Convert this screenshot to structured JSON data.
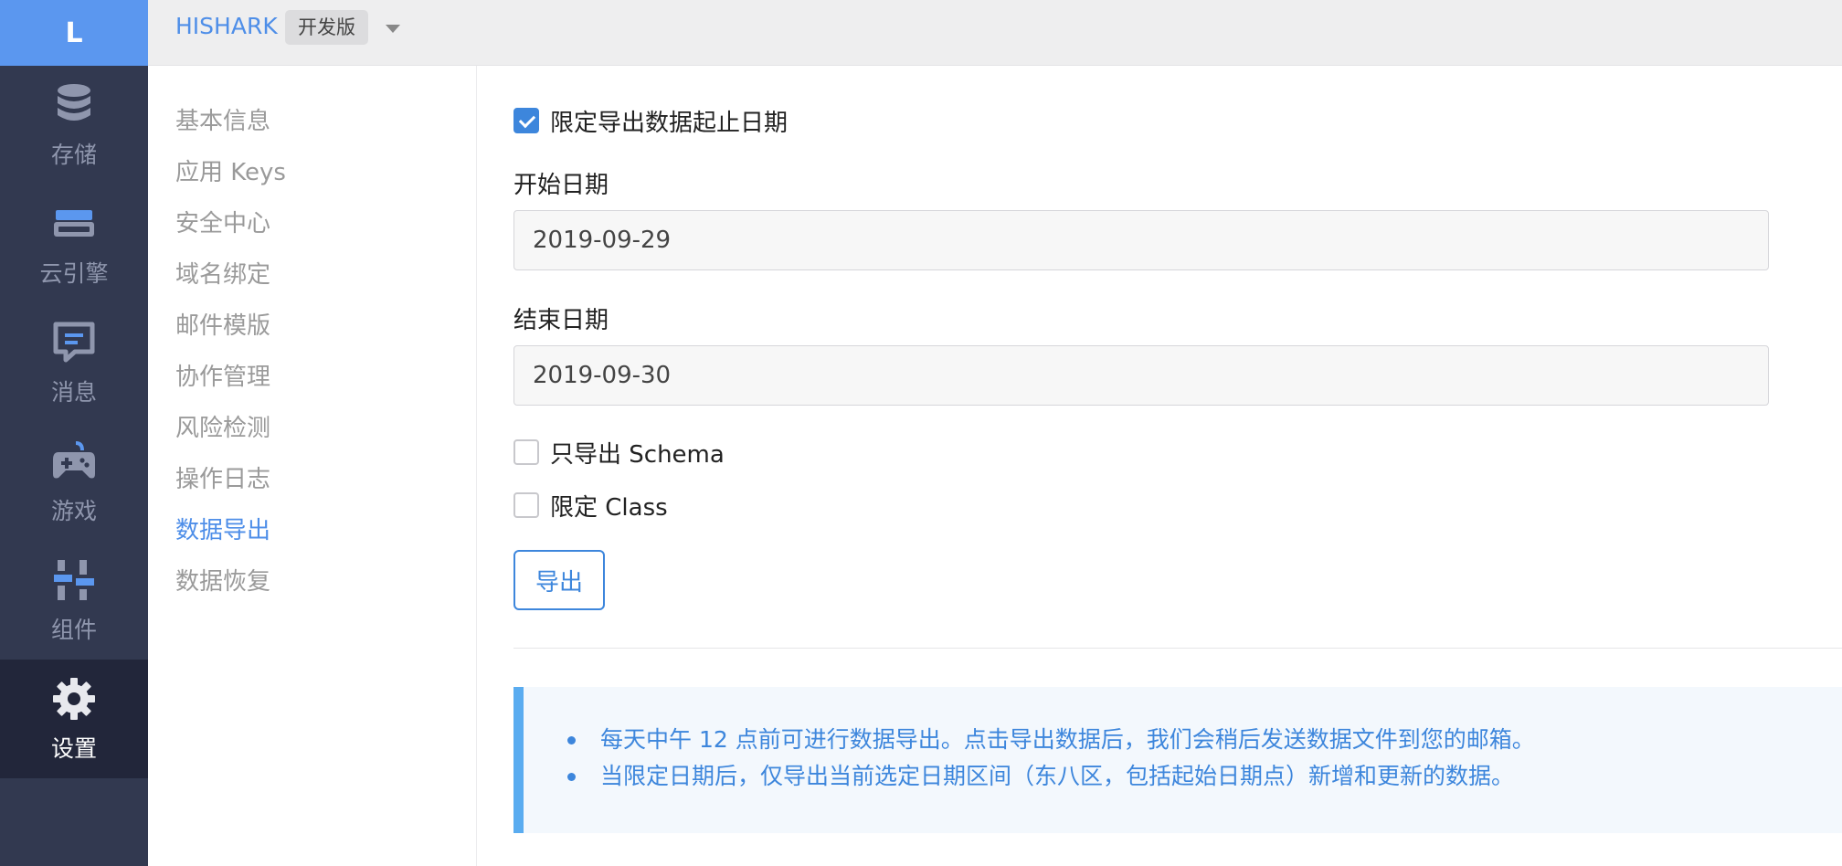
{
  "app": {
    "logo_letter": "L",
    "name": "HISHARK",
    "env_badge": "开发版"
  },
  "rail": {
    "items": [
      {
        "label": "存储",
        "icon": "database-icon"
      },
      {
        "label": "云引擎",
        "icon": "server-icon"
      },
      {
        "label": "消息",
        "icon": "message-icon"
      },
      {
        "label": "游戏",
        "icon": "gamepad-icon"
      },
      {
        "label": "组件",
        "icon": "components-icon"
      },
      {
        "label": "设置",
        "icon": "gear-icon",
        "active": true
      }
    ]
  },
  "subnav": {
    "items": [
      "基本信息",
      "应用 Keys",
      "安全中心",
      "域名绑定",
      "邮件模版",
      "协作管理",
      "风险检测",
      "操作日志",
      "数据导出",
      "数据恢复"
    ],
    "active": "数据导出"
  },
  "form": {
    "limit_dates_label": "限定导出数据起止日期",
    "limit_dates_checked": true,
    "start_label": "开始日期",
    "start_value": "2019-09-29",
    "end_label": "结束日期",
    "end_value": "2019-09-30",
    "schema_only_label": "只导出 Schema",
    "schema_only_checked": false,
    "limit_class_label": "限定 Class",
    "limit_class_checked": false,
    "export_button": "导出"
  },
  "notice": {
    "items": [
      "每天中午 12 点前可进行数据导出。点击导出数据后，我们会稍后发送数据文件到您的邮箱。",
      "当限定日期后，仅导出当前选定日期区间（东八区，包括起始日期点）新增和更新的数据。"
    ]
  },
  "colors": {
    "accent": "#3d86dc",
    "rail_bg": "#323950",
    "rail_active_bg": "#22263a",
    "logo_bg": "#5b97ef",
    "notice_border": "#5aacf0"
  }
}
